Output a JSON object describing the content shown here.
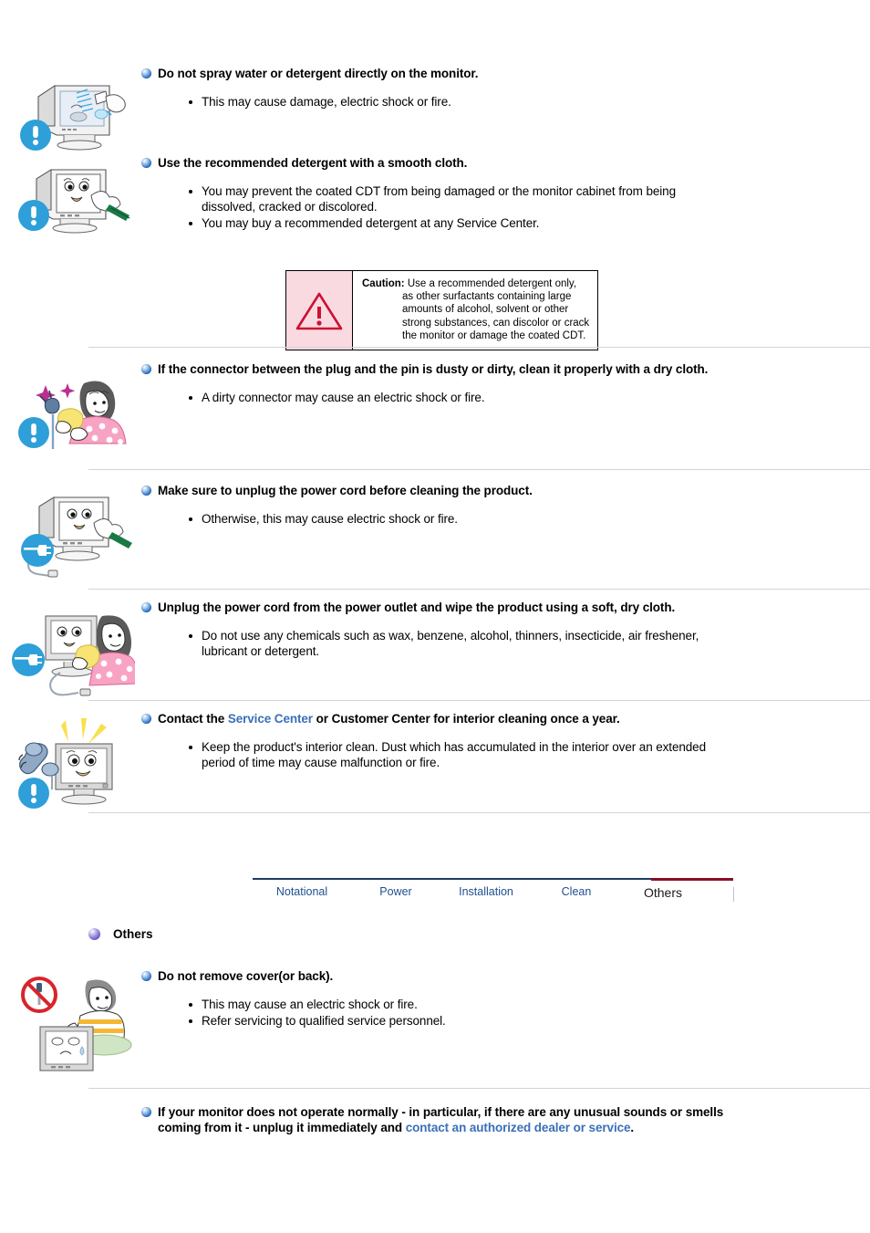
{
  "sections": [
    {
      "id": "spray",
      "heading": "Do not spray water or detergent directly on the monitor.",
      "bullets": [
        "This may cause damage, electric shock or fire."
      ],
      "illustration": "monitor-spray-bottle-illustration"
    },
    {
      "id": "detergent",
      "heading": "Use the recommended detergent with a smooth cloth.",
      "bullets": [
        "You may prevent the coated CDT from being damaged or the monitor cabinet from being dissolved, cracked or discolored.",
        "You may buy a recommended detergent at any Service Center."
      ],
      "illustration": "monitor-wipe-cloth-illustration"
    },
    {
      "id": "connector",
      "heading": "If the connector between the plug and the pin is dusty or dirty, clean it properly with a dry cloth.",
      "bullets": [
        "A dirty connector may cause an electric shock or fire."
      ],
      "illustration": "woman-cleaning-plug-illustration"
    },
    {
      "id": "unplug-before-clean",
      "heading": "Make sure to unplug the power cord before cleaning the product.",
      "bullets": [
        "Otherwise, this may cause electric shock or fire."
      ],
      "illustration": "monitor-unplug-illustration"
    },
    {
      "id": "wipe-soft-cloth",
      "heading": "Unplug the power cord from the power outlet and wipe the product using a soft, dry cloth.",
      "bullets": [
        "Do not use any chemicals such as wax, benzene, alcohol, thinners, insecticide, air freshener, lubricant or detergent."
      ],
      "illustration": "woman-wiping-monitor-illustration"
    },
    {
      "id": "service-center",
      "heading_pre": "Contact the ",
      "heading_link": "Service Center",
      "heading_post": " or Customer Center for interior cleaning once a year.",
      "bullets": [
        "Keep the product's interior clean. Dust which has accumulated in the interior over an extended period of time may cause malfunction or fire."
      ],
      "illustration": "monitor-phone-call-illustration"
    }
  ],
  "caution": {
    "label": "Caution:",
    "lines": [
      "Use a recommended detergent only,",
      "as other surfactants containing large",
      "amounts of alcohol, solvent or other",
      "strong substances, can discolor or crack",
      "the monitor or damage the coated CDT."
    ],
    "icon": "warning-triangle-icon",
    "bg_color": "#fadae1",
    "border_color": "#000000",
    "triangle_color": "#cc1133"
  },
  "tabs": {
    "items": [
      {
        "label": "Notational",
        "active": false
      },
      {
        "label": "Power",
        "active": false
      },
      {
        "label": "Installation",
        "active": false
      },
      {
        "label": "Clean",
        "active": false
      },
      {
        "label": "Others",
        "active": true
      }
    ],
    "active_color": "#8a0f24",
    "inactive_color": "#1f4f8f"
  },
  "others_section": {
    "label": "Others",
    "bullet_icon": "purple-sphere-bullet-icon"
  },
  "others_items": [
    {
      "id": "remove-cover",
      "heading": "Do not remove cover(or back).",
      "bullets": [
        "This may cause an electric shock or fire.",
        "Refer servicing to qualified service personnel."
      ],
      "illustration": "no-screwdriver-open-cover-illustration"
    },
    {
      "id": "abnormal-operation",
      "heading_pre": "If your monitor does not operate normally - in particular, if there are any unusual sounds or smells coming from it - unplug it immediately and ",
      "heading_link": "contact an authorized dealer or service",
      "heading_post": ".",
      "illustration": null
    }
  ]
}
